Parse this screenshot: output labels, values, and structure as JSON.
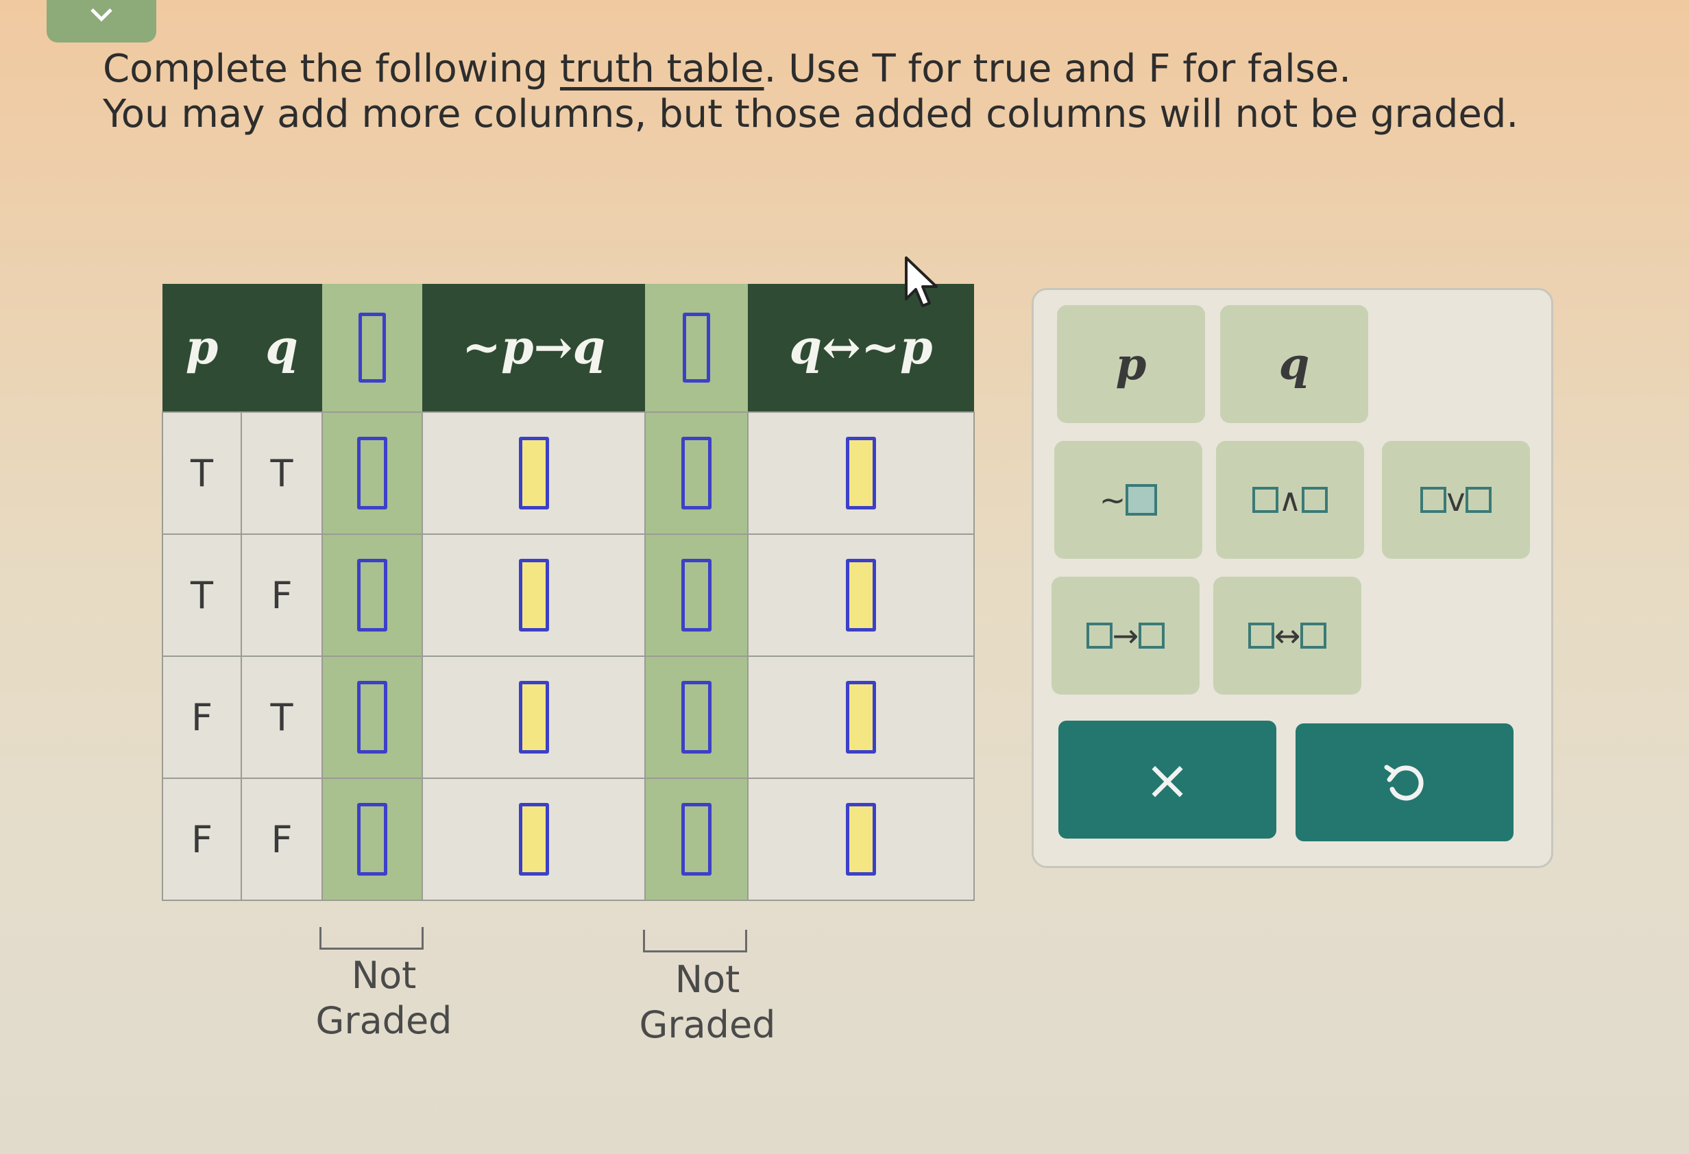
{
  "instructions": {
    "line1_prefix": "Complete the following ",
    "line1_link": "truth table",
    "line1_suffix": ". Use T for true and F for false.",
    "line2": "You may add more columns, but those added columns will not be graded."
  },
  "table": {
    "headers": {
      "p": "p",
      "q": "q",
      "col4": "~p→q",
      "col6": "q↔~p"
    },
    "rows": [
      {
        "p": "T",
        "q": "T"
      },
      {
        "p": "T",
        "q": "F"
      },
      {
        "p": "F",
        "q": "T"
      },
      {
        "p": "F",
        "q": "F"
      }
    ],
    "not_graded_line1": "Not",
    "not_graded_line2": "Graded"
  },
  "keypad": {
    "p": "p",
    "q": "q",
    "not_symbol": "~",
    "and_symbol": "∧",
    "or_symbol": "v",
    "implies_symbol": "→",
    "iff_symbol": "↔",
    "clear_label": "×"
  },
  "colors": {
    "header_bg": "#2f4b34",
    "not_graded_bg": "#a9c08f",
    "keypad_button": "#c8d2b3",
    "action_button": "#23776e",
    "input_border": "#3c40c8",
    "graded_input_fill": "#f4e683"
  }
}
